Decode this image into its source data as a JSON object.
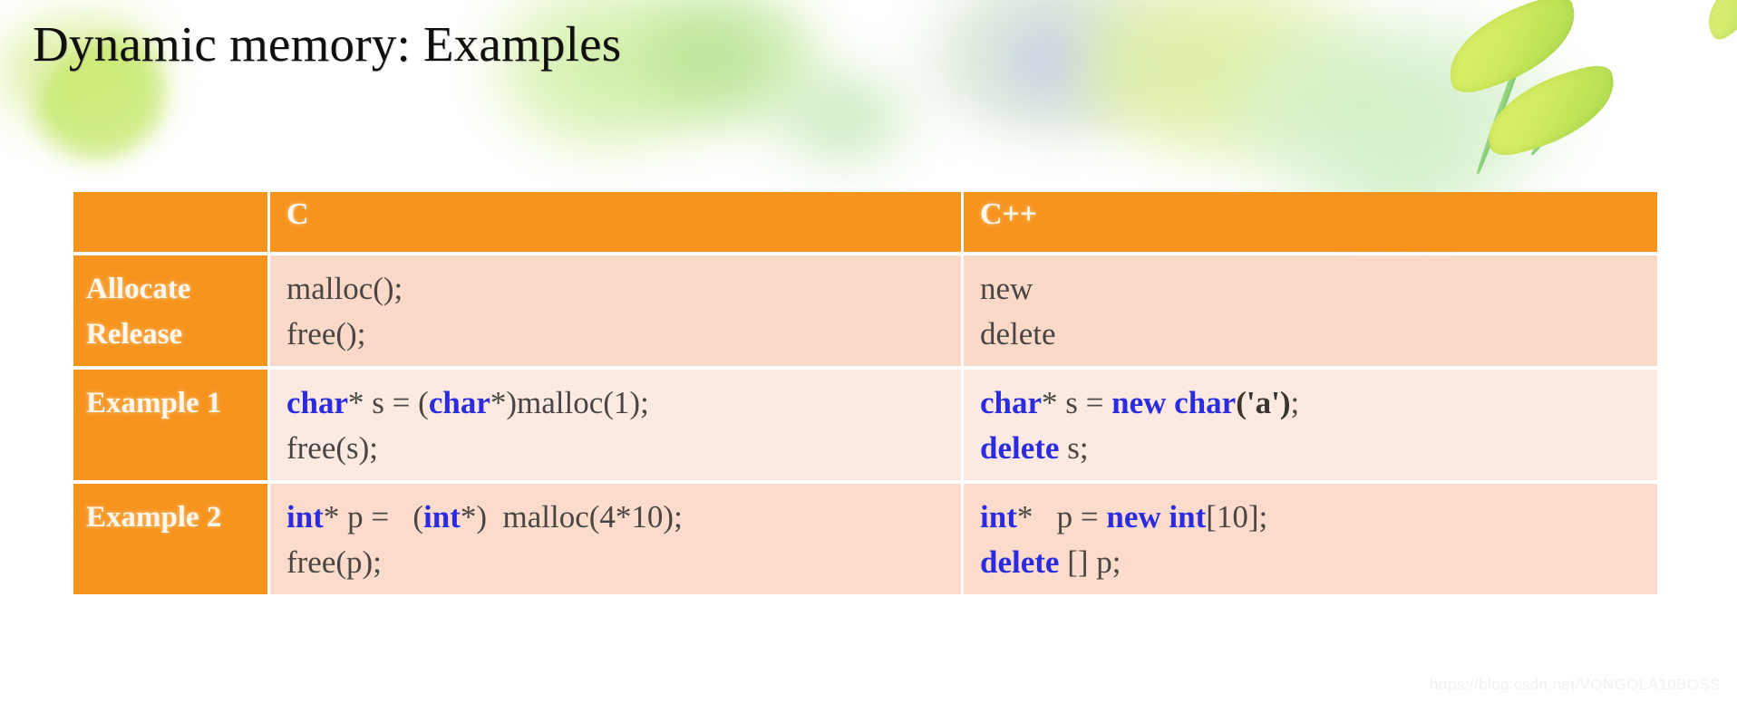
{
  "slide": {
    "title": "Dynamic memory: Examples",
    "watermark": "https://blog.csdn.net/VONGOLA10BOSS",
    "accent_orange": "#F7941E",
    "keyword_blue": "#2B2BE0",
    "row_pink_dark": "#FBD9C9",
    "row_pink_light": "#FCEAE2",
    "header_text_color": "#FFF6EC"
  },
  "table": {
    "headers": {
      "corner": "",
      "c": "C",
      "cpp": "C++"
    },
    "rows": [
      {
        "label_line1": "Allocate",
        "label_line2": "Release",
        "c": {
          "line1": {
            "plain": "malloc();"
          },
          "line2": {
            "plain": "free();"
          }
        },
        "cpp": {
          "line1": {
            "plain": "new"
          },
          "line2": {
            "plain": "delete"
          }
        }
      },
      {
        "label_line1": "Example 1",
        "label_line2": "",
        "c": {
          "line1": {
            "kw1": "char",
            "mid1": "* s = (",
            "kw2": "char",
            "mid2": "*)malloc(1);"
          },
          "line2": {
            "plain": "free(s);"
          }
        },
        "cpp": {
          "line1": {
            "kw1": "char",
            "mid1": "* s = ",
            "kw2": "new char",
            "char_lit": "('a')",
            "tail": ";"
          },
          "line2": {
            "kw1": "delete",
            "tail": " s;"
          }
        }
      },
      {
        "label_line1": "Example 2",
        "label_line2": "",
        "c": {
          "line1": {
            "kw1": "int",
            "mid1": "* p =   (",
            "kw2": "int",
            "mid2": "*)  malloc(4*10);"
          },
          "line2": {
            "plain": "free(p);"
          }
        },
        "cpp": {
          "line1": {
            "kw1": "int",
            "mid1": "*   p = ",
            "kw2": "new int",
            "tail": "[10];"
          },
          "line2": {
            "kw1": "delete",
            "tail": " [] p;"
          }
        }
      }
    ]
  }
}
